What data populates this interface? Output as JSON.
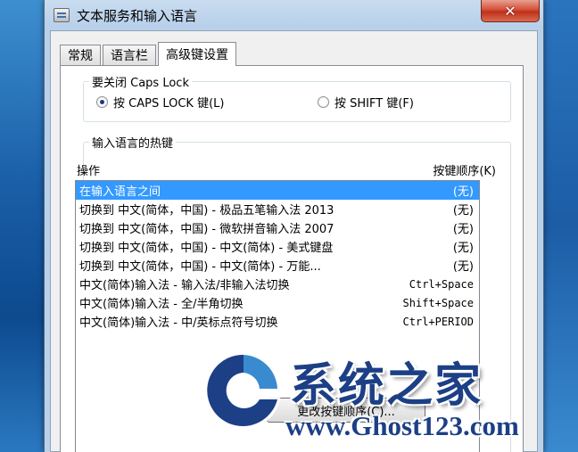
{
  "window": {
    "title": "文本服务和输入语言",
    "close_label": "✕"
  },
  "tabs": [
    {
      "label": "常规",
      "active": false
    },
    {
      "label": "语言栏",
      "active": false
    },
    {
      "label": "高级键设置",
      "active": true
    }
  ],
  "caps_lock_group": {
    "legend": "要关闭 Caps Lock",
    "options": [
      {
        "label": "按 CAPS LOCK 键(L)",
        "selected": true
      },
      {
        "label": "按 SHIFT 键(F)",
        "selected": false
      }
    ]
  },
  "hotkey_group": {
    "legend": "输入语言的热键",
    "col_action": "操作",
    "col_sequence": "按键顺序(K)",
    "rows": [
      {
        "action": "在输入语言之间",
        "keys": "(无)"
      },
      {
        "action": "切换到 中文(简体，中国) - 极品五笔输入法 2013",
        "keys": "(无)"
      },
      {
        "action": "切换到 中文(简体，中国) - 微软拼音输入法 2007",
        "keys": "(无)"
      },
      {
        "action": "切换到 中文(简体，中国) - 中文(简体) - 美式键盘",
        "keys": "(无)"
      },
      {
        "action": "切换到 中文(简体，中国) - 中文(简体) - 万能...",
        "keys": "(无)"
      },
      {
        "action": "中文(简体)输入法 - 输入法/非输入法切换",
        "keys": "Ctrl+Space"
      },
      {
        "action": "中文(简体)输入法 - 全/半角切换",
        "keys": "Shift+Space"
      },
      {
        "action": "中文(简体)输入法 - 中/英标点符号切换",
        "keys": "Ctrl+PERIOD"
      }
    ],
    "selected_index": 0,
    "change_button": "更改按键顺序(C)..."
  },
  "watermark": {
    "title": "系统之家",
    "url": "www.Ghost123.com"
  },
  "colors": {
    "selection": "#3399ff",
    "watermark": "#1c3f86"
  }
}
